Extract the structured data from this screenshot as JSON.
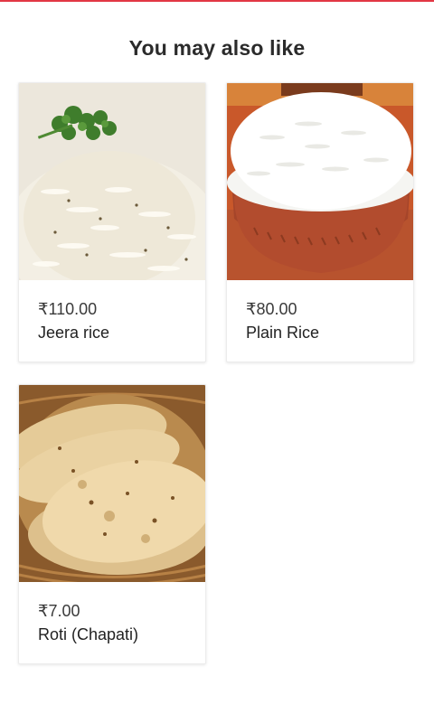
{
  "section": {
    "title": "You may also like"
  },
  "items": [
    {
      "price": "₹110.00",
      "name": "Jeera rice",
      "image": "jeera-rice-image"
    },
    {
      "price": "₹80.00",
      "name": "Plain Rice",
      "image": "plain-rice-image"
    },
    {
      "price": "₹7.00",
      "name": "Roti (Chapati)",
      "image": "roti-image"
    }
  ],
  "colors": {
    "accent": "#e23744"
  }
}
